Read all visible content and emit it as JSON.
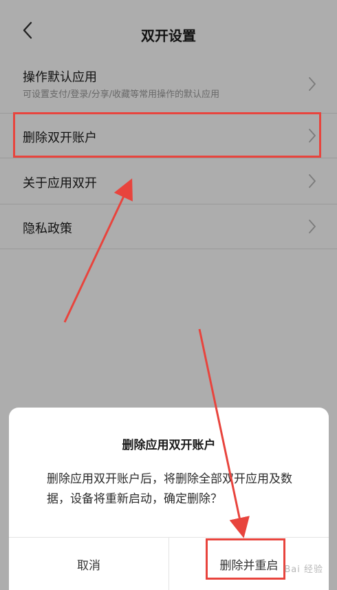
{
  "header": {
    "title": "双开设置"
  },
  "list": {
    "items": [
      {
        "label": "操作默认应用",
        "sub": "可设置支付/登录/分享/收藏等常用操作的默认应用"
      },
      {
        "label": "删除双开账户"
      },
      {
        "label": "关于应用双开"
      },
      {
        "label": "隐私政策"
      }
    ]
  },
  "dialog": {
    "title": "删除应用双开账户",
    "message": "删除应用双开账户后，将删除全部双开应用及数据，设备将重新启动，确定删除？",
    "cancel_label": "取消",
    "confirm_label": "删除并重启"
  },
  "colors": {
    "highlight": "#e8443d",
    "overlay": "rgba(0,0,0,0.32)"
  },
  "icons": {
    "back": "chevron-left-icon",
    "row_arrow": "chevron-right-icon"
  }
}
